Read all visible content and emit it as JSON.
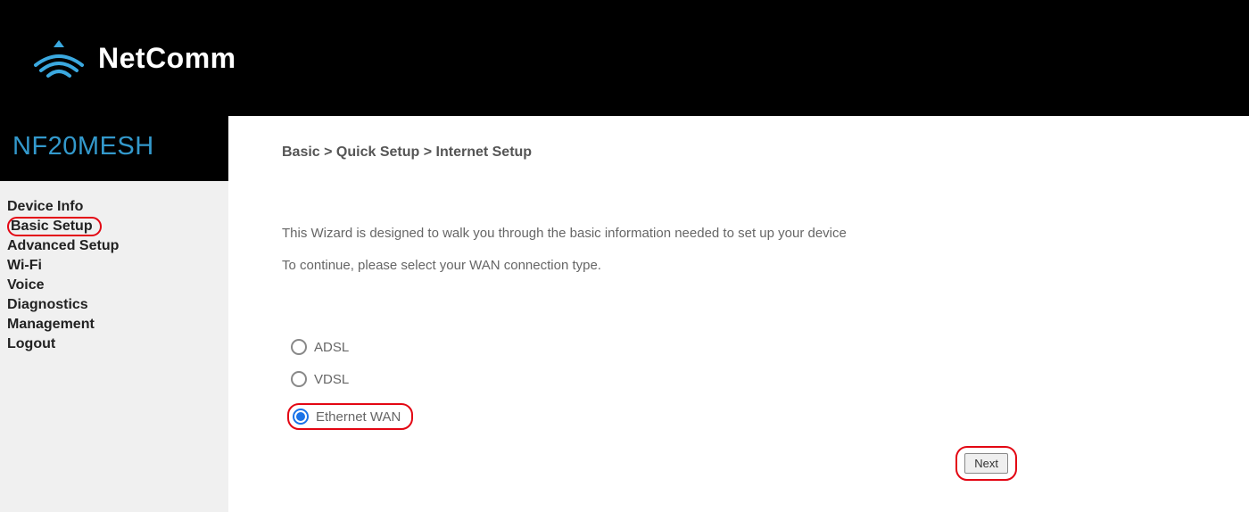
{
  "brand": "NetComm",
  "model": "NF20MESH",
  "sidebar": {
    "items": [
      {
        "label": "Device Info",
        "highlighted": false
      },
      {
        "label": "Basic Setup",
        "highlighted": true
      },
      {
        "label": "Advanced Setup",
        "highlighted": false
      },
      {
        "label": "Wi-Fi",
        "highlighted": false
      },
      {
        "label": "Voice",
        "highlighted": false
      },
      {
        "label": "Diagnostics",
        "highlighted": false
      },
      {
        "label": "Management",
        "highlighted": false
      },
      {
        "label": "Logout",
        "highlighted": false
      }
    ]
  },
  "breadcrumb": "Basic > Quick Setup > Internet Setup",
  "wizard": {
    "line1": "This Wizard is designed to walk you through the basic information needed to set up your device",
    "line2": "To continue, please select your WAN connection type."
  },
  "wan_options": [
    {
      "label": "ADSL",
      "checked": false,
      "highlighted": false
    },
    {
      "label": "VDSL",
      "checked": false,
      "highlighted": false
    },
    {
      "label": "Ethernet WAN",
      "checked": true,
      "highlighted": true
    }
  ],
  "next_label": "Next",
  "highlight_color": "#e30613",
  "accent_color": "#3399cc",
  "radio_checked_color": "#1a73e8"
}
